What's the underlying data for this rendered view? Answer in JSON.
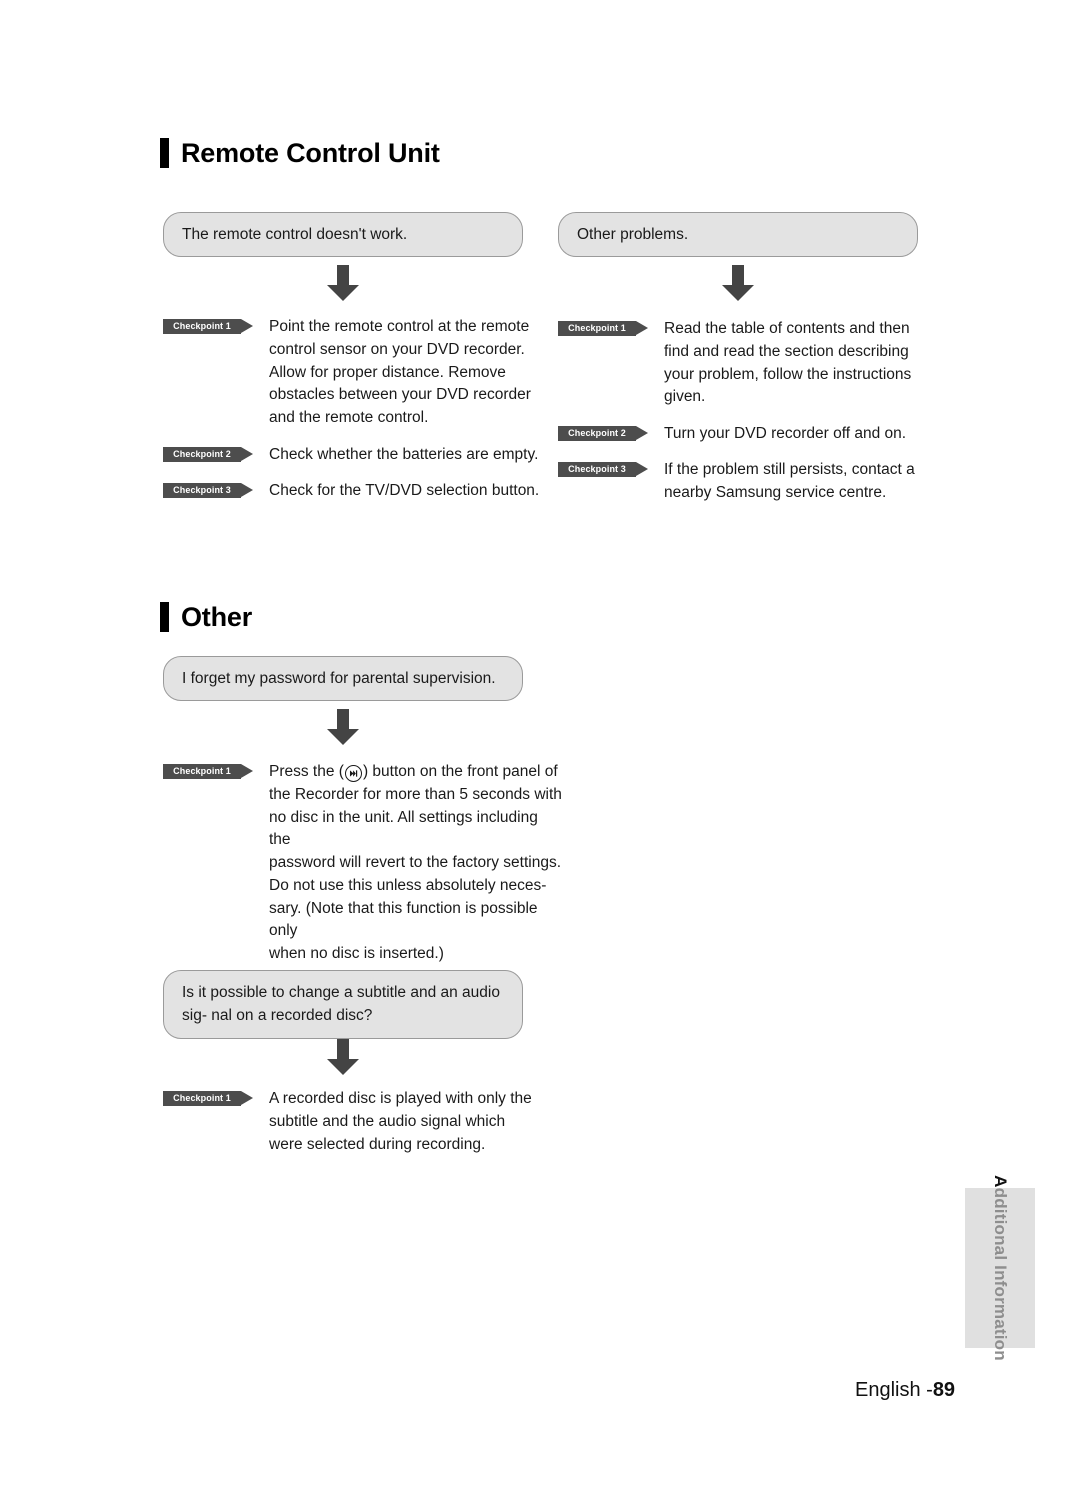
{
  "page": {
    "footer_prefix": "English -",
    "page_number": "89",
    "side_tab_lead": "A",
    "side_tab_rest": "dditional Information"
  },
  "sections": [
    {
      "id": "remote-control-unit",
      "title": "Remote Control Unit",
      "columns": [
        {
          "id": "remote-doesnt-work",
          "question": "The remote control doesn't work.",
          "checkpoints": [
            {
              "label": "Checkpoint 1",
              "text": "Point the remote control at the remote\ncontrol sensor on your DVD recorder.\nAllow for proper distance. Remove\nobstacles between your DVD recorder\nand the remote control."
            },
            {
              "label": "Checkpoint 2",
              "text": "Check whether the batteries are empty."
            },
            {
              "label": "Checkpoint 3",
              "text": "Check for the TV/DVD selection button."
            }
          ]
        },
        {
          "id": "other-problems",
          "question": "Other problems.",
          "checkpoints": [
            {
              "label": "Checkpoint 1",
              "text": "Read the table of contents and then\nfind and read the section describing\nyour problem, follow the instructions\ngiven."
            },
            {
              "label": "Checkpoint 2",
              "text": "Turn your DVD recorder off and on."
            },
            {
              "label": "Checkpoint 3",
              "text": "If the problem still persists, contact a\nnearby Samsung service centre."
            }
          ]
        }
      ]
    },
    {
      "id": "other",
      "title": "Other",
      "columns": [
        {
          "id": "forgot-password",
          "question": "I forget my password for parental supervision.",
          "checkpoints": [
            {
              "label": "Checkpoint 1",
              "text_before_glyph": "Press the (",
              "glyph_name": "skip-next-button-icon",
              "text_after_glyph": ") button on the front panel of\nthe Recorder for more than 5 seconds with\nno disc in the unit.  All settings including the\npassword will revert to the factory settings.\nDo not use this unless absolutely neces-\nsary. (Note that this function is possible only\nwhen no disc is inserted.)"
            }
          ]
        },
        {
          "id": "change-subtitle-audio",
          "question": "Is it possible to change a subtitle and an audio sig-\nnal on a recorded disc?",
          "checkpoints": [
            {
              "label": "Checkpoint 1",
              "text": "A recorded disc is played with only the\nsubtitle and the audio signal which\nwere selected during recording."
            }
          ]
        }
      ]
    }
  ],
  "colors": {
    "pill_fill": "#e3e3e3",
    "pill_border": "#9a9a9a",
    "badge": "#4d4d4d",
    "arrow": "#444444",
    "side_tab": "#e0e0e0",
    "side_tab_text": "#8e8e8e"
  }
}
